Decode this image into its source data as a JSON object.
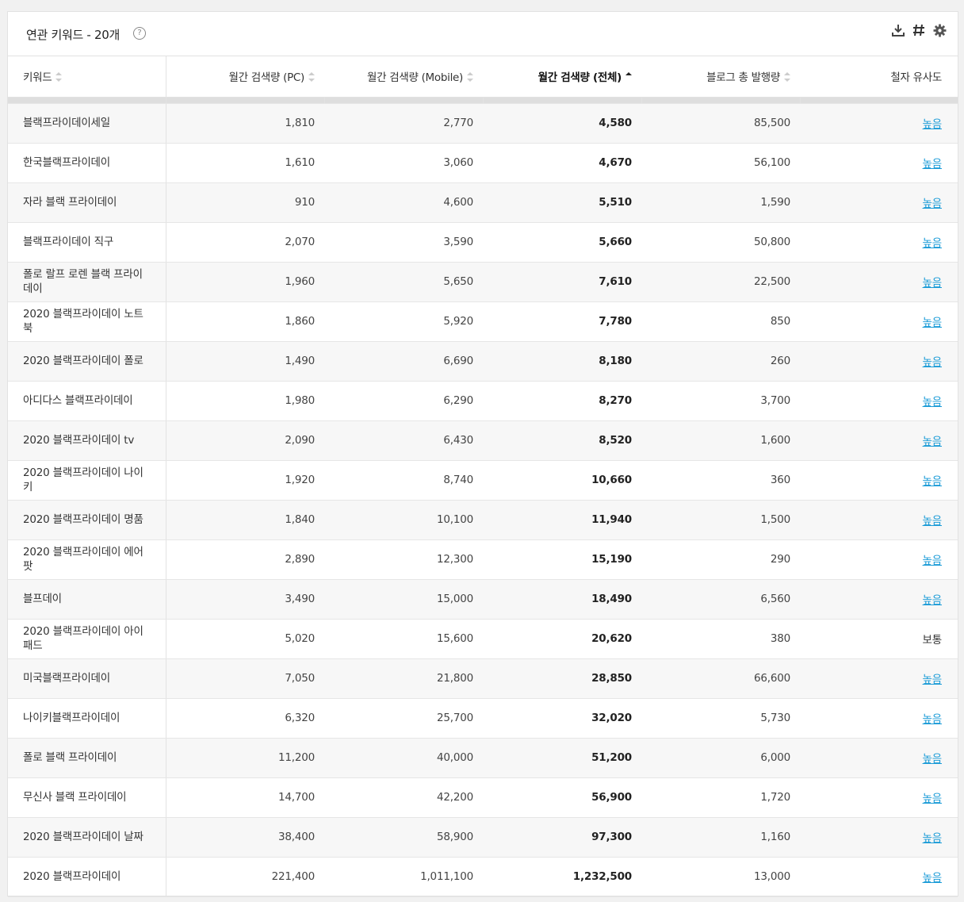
{
  "panel": {
    "title": "연관 키워드 - 20개",
    "help_icon": "?",
    "tools": [
      "download-icon",
      "hash-icon",
      "gear-icon"
    ]
  },
  "columns": [
    {
      "label": "키워드",
      "sort": "none"
    },
    {
      "label": "월간 검색량 (PC)",
      "sort": "none"
    },
    {
      "label": "월간 검색량 (Mobile)",
      "sort": "none"
    },
    {
      "label": "월간 검색량 (전체)",
      "sort": "asc"
    },
    {
      "label": "블로그 총 발행량",
      "sort": "none"
    },
    {
      "label": "철자 유사도",
      "sort": null
    }
  ],
  "rows": [
    {
      "keyword": "블랙프라이데이세일",
      "pc": "1,810",
      "mobile": "2,770",
      "total": "4,580",
      "blog": "85,500",
      "similarity": "높음"
    },
    {
      "keyword": "한국블랙프라이데이",
      "pc": "1,610",
      "mobile": "3,060",
      "total": "4,670",
      "blog": "56,100",
      "similarity": "높음"
    },
    {
      "keyword": "자라 블랙 프라이데이",
      "pc": "910",
      "mobile": "4,600",
      "total": "5,510",
      "blog": "1,590",
      "similarity": "높음"
    },
    {
      "keyword": "블랙프라이데이 직구",
      "pc": "2,070",
      "mobile": "3,590",
      "total": "5,660",
      "blog": "50,800",
      "similarity": "높음"
    },
    {
      "keyword": "폴로 랄프 로렌 블랙 프라이데이",
      "pc": "1,960",
      "mobile": "5,650",
      "total": "7,610",
      "blog": "22,500",
      "similarity": "높음"
    },
    {
      "keyword": "2020 블랙프라이데이 노트북",
      "pc": "1,860",
      "mobile": "5,920",
      "total": "7,780",
      "blog": "850",
      "similarity": "높음"
    },
    {
      "keyword": "2020 블랙프라이데이 폴로",
      "pc": "1,490",
      "mobile": "6,690",
      "total": "8,180",
      "blog": "260",
      "similarity": "높음"
    },
    {
      "keyword": "아디다스 블랙프라이데이",
      "pc": "1,980",
      "mobile": "6,290",
      "total": "8,270",
      "blog": "3,700",
      "similarity": "높음"
    },
    {
      "keyword": "2020 블랙프라이데이 tv",
      "pc": "2,090",
      "mobile": "6,430",
      "total": "8,520",
      "blog": "1,600",
      "similarity": "높음"
    },
    {
      "keyword": "2020 블랙프라이데이 나이키",
      "pc": "1,920",
      "mobile": "8,740",
      "total": "10,660",
      "blog": "360",
      "similarity": "높음"
    },
    {
      "keyword": "2020 블랙프라이데이 명품",
      "pc": "1,840",
      "mobile": "10,100",
      "total": "11,940",
      "blog": "1,500",
      "similarity": "높음"
    },
    {
      "keyword": "2020 블랙프라이데이 에어팟",
      "pc": "2,890",
      "mobile": "12,300",
      "total": "15,190",
      "blog": "290",
      "similarity": "높음"
    },
    {
      "keyword": "블프데이",
      "pc": "3,490",
      "mobile": "15,000",
      "total": "18,490",
      "blog": "6,560",
      "similarity": "높음"
    },
    {
      "keyword": "2020 블랙프라이데이 아이패드",
      "pc": "5,020",
      "mobile": "15,600",
      "total": "20,620",
      "blog": "380",
      "similarity": "보통"
    },
    {
      "keyword": "미국블랙프라이데이",
      "pc": "7,050",
      "mobile": "21,800",
      "total": "28,850",
      "blog": "66,600",
      "similarity": "높음"
    },
    {
      "keyword": "나이키블랙프라이데이",
      "pc": "6,320",
      "mobile": "25,700",
      "total": "32,020",
      "blog": "5,730",
      "similarity": "높음"
    },
    {
      "keyword": "폴로 블랙 프라이데이",
      "pc": "11,200",
      "mobile": "40,000",
      "total": "51,200",
      "blog": "6,000",
      "similarity": "높음"
    },
    {
      "keyword": "무신사 블랙 프라이데이",
      "pc": "14,700",
      "mobile": "42,200",
      "total": "56,900",
      "blog": "1,720",
      "similarity": "높음"
    },
    {
      "keyword": "2020 블랙프라이데이 날짜",
      "pc": "38,400",
      "mobile": "58,900",
      "total": "97,300",
      "blog": "1,160",
      "similarity": "높음"
    },
    {
      "keyword": "2020 블랙프라이데이",
      "pc": "221,400",
      "mobile": "1,011,100",
      "total": "1,232,500",
      "blog": "13,000",
      "similarity": "높음"
    }
  ],
  "colors": {
    "link": "#1a9bd7",
    "spacer": "#dedede",
    "zebra": "#f7f7f7"
  }
}
